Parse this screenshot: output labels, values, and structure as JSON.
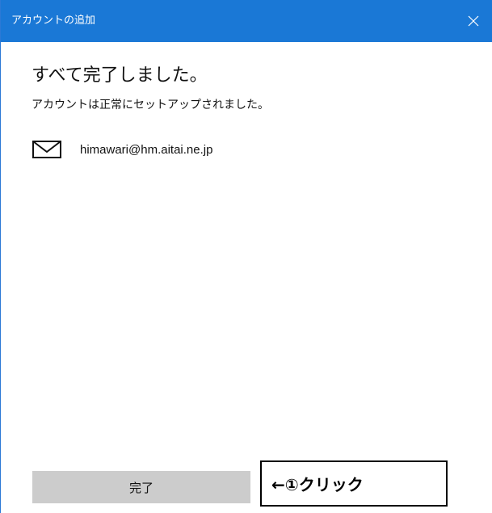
{
  "window": {
    "title": "アカウントの追加",
    "close_icon": "close-icon"
  },
  "content": {
    "heading": "すべて完了しました。",
    "subtext": "アカウントは正常にセットアップされました。",
    "account": {
      "icon": "mail-icon",
      "email": "himawari@hm.aitai.ne.jp"
    }
  },
  "footer": {
    "done_label": "完了"
  },
  "annotation": {
    "text": "←①クリック"
  },
  "colors": {
    "titlebar": "#1a78d6",
    "button": "#cccccc"
  }
}
